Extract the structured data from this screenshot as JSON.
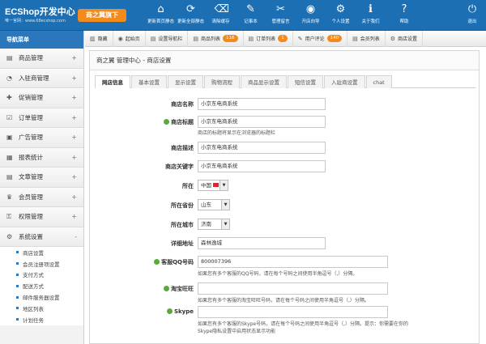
{
  "header": {
    "logo": "ECShop开发中心",
    "logo_sub": "唯一官网：www.68ecshop.com",
    "brand": "商之翼旗下",
    "nav": [
      {
        "label": "更新首页静态",
        "icon": "home-icon",
        "glyph": "⌂"
      },
      {
        "label": "更新全部静态",
        "icon": "refresh-icon",
        "glyph": "⟳"
      },
      {
        "label": "清除缓存",
        "icon": "clear-cache-icon",
        "glyph": "⌫"
      },
      {
        "label": "记事本",
        "icon": "notepad-icon",
        "glyph": "✎"
      },
      {
        "label": "管理留言",
        "icon": "wrench-icon",
        "glyph": "✂"
      },
      {
        "label": "开店向导",
        "icon": "shop-guide-icon",
        "glyph": "◉"
      },
      {
        "label": "个人设置",
        "icon": "gear-icon",
        "glyph": "⚙"
      },
      {
        "label": "关于我们",
        "icon": "info-icon",
        "glyph": "ℹ"
      }
    ],
    "help": {
      "label": "帮助",
      "glyph": "?"
    },
    "exit": {
      "label": "退出",
      "glyph": "⏻"
    }
  },
  "sidebar": {
    "title": "导航菜单",
    "items": [
      {
        "label": "商品管理",
        "glyph": "▤",
        "icon": "goods-icon"
      },
      {
        "label": "入驻商管理",
        "glyph": "◔",
        "icon": "merchant-icon"
      },
      {
        "label": "促销管理",
        "glyph": "✚",
        "icon": "promotion-icon"
      },
      {
        "label": "订单管理",
        "glyph": "☑",
        "icon": "order-icon"
      },
      {
        "label": "广告管理",
        "glyph": "▣",
        "icon": "ad-icon"
      },
      {
        "label": "报表统计",
        "glyph": "▦",
        "icon": "report-icon"
      },
      {
        "label": "文章管理",
        "glyph": "▤",
        "icon": "article-icon"
      },
      {
        "label": "会员管理",
        "glyph": "♛",
        "icon": "vip-icon"
      },
      {
        "label": "权限管理",
        "glyph": "⚿",
        "icon": "permission-icon"
      },
      {
        "label": "系统设置",
        "glyph": "⚙",
        "icon": "system-icon",
        "expanded": true
      }
    ],
    "subitems": [
      "商店设置",
      "会员注册项设置",
      "支付方式",
      "配送方式",
      "邮件服务器设置",
      "地区列表",
      "计划任务"
    ],
    "plus": "+",
    "minus": "-"
  },
  "toolbar": [
    {
      "label": "隐藏",
      "glyph": "▥",
      "icon": "hide-icon"
    },
    {
      "label": "起始页",
      "glyph": "◉",
      "icon": "start-page-icon"
    },
    {
      "label": "设置导航栏",
      "glyph": "▤",
      "icon": "nav-setting-icon"
    },
    {
      "label": "商品列表",
      "glyph": "▤",
      "icon": "goods-list-icon",
      "badge": "116"
    },
    {
      "label": "订单列表",
      "glyph": "▤",
      "icon": "order-list-icon",
      "badge": "1"
    },
    {
      "label": "用户评论",
      "glyph": "✎",
      "icon": "comment-icon",
      "badge": "140"
    },
    {
      "label": "会员列表",
      "glyph": "▤",
      "icon": "member-list-icon"
    },
    {
      "label": "商店设置",
      "glyph": "⚙",
      "icon": "shop-setting-icon"
    }
  ],
  "main": {
    "title": "商之翼 管理中心 - 商店设置",
    "tabs": [
      "网店信息",
      "基本设置",
      "显示设置",
      "购物流程",
      "商品显示设置",
      "短信设置",
      "入驻商设置",
      "chat"
    ],
    "form": {
      "shop_name": {
        "label": "商店名称",
        "value": "小京东电商系统"
      },
      "shop_title": {
        "label": "商店标题",
        "value": "小京东电商系统",
        "hint": "商店的标题将显示在浏览器的标题栏"
      },
      "shop_desc": {
        "label": "商店描述",
        "value": "小京东电商系统"
      },
      "shop_keywords": {
        "label": "商店关键字",
        "value": "小京东电商系统"
      },
      "country": {
        "label": "所在",
        "value": "中国"
      },
      "province": {
        "label": "所在省份",
        "value": "山东"
      },
      "city": {
        "label": "所在城市",
        "value": "济南"
      },
      "address": {
        "label": "详细地址",
        "value": "森林逸城"
      },
      "qq": {
        "label": "客服QQ号码",
        "value": "800007396",
        "hint": "如果您有多个客服的QQ号码，请在每个号码之间使用半角逗号（,）分隔。"
      },
      "taobao": {
        "label": "淘宝旺旺",
        "value": "",
        "hint": "如果您有多个客服的淘宝旺旺号码，请在每个号码之间使用半角逗号（,）分隔。"
      },
      "skype": {
        "label": "Skype",
        "value": "",
        "hint1": "如果您有多个客服的Skype号码，请在每个号码之间使用半角逗号（,）分隔。提示：你需要在你的",
        "hint2": "Skype隐私设置中启用状态显示功能"
      }
    }
  }
}
